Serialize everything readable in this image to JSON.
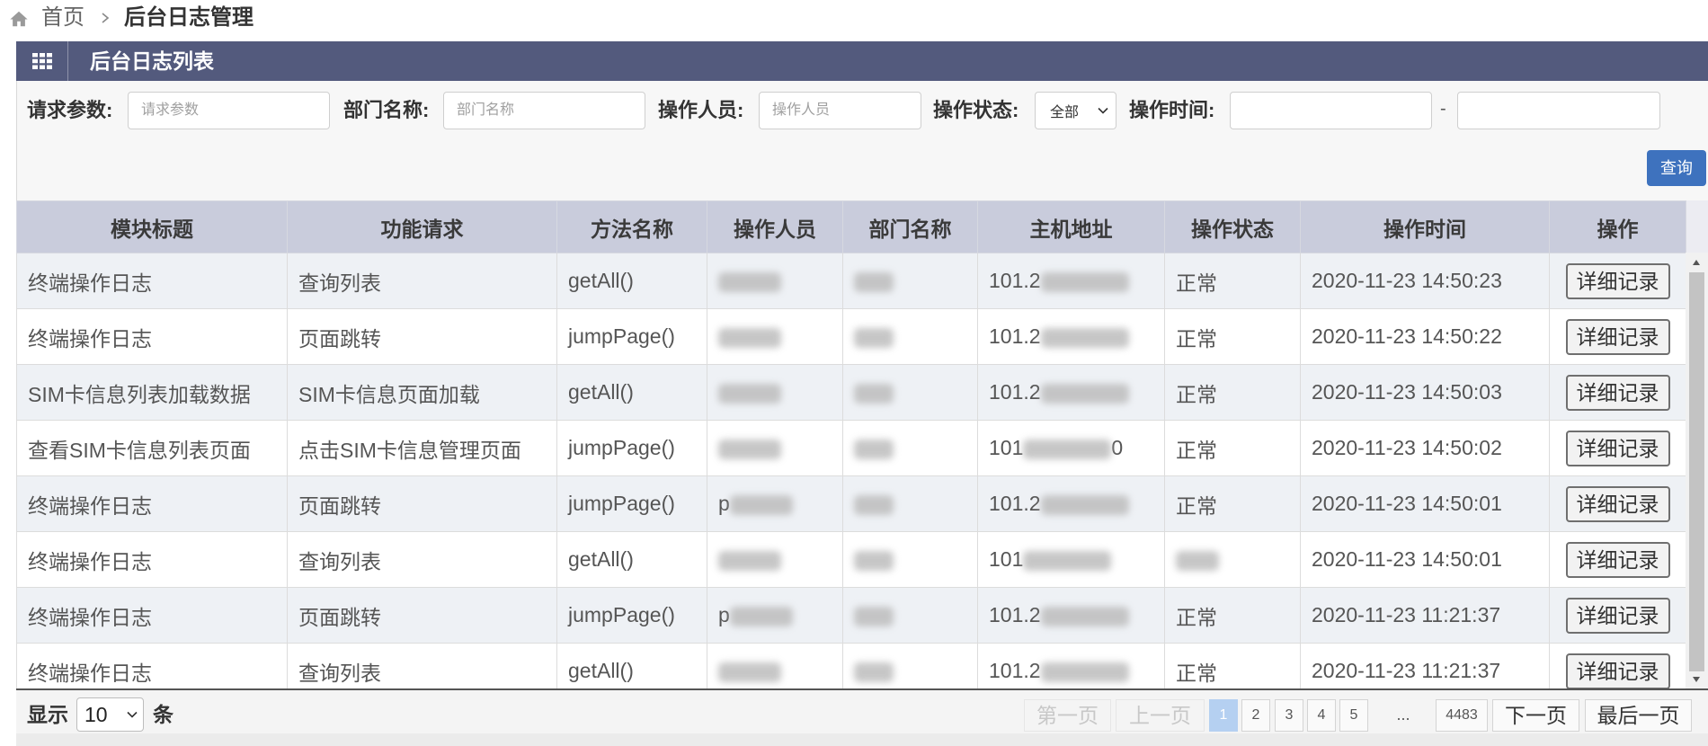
{
  "breadcrumb": {
    "home": "首页",
    "current": "后台日志管理"
  },
  "panel": {
    "title": "后台日志列表"
  },
  "filters": {
    "request_params": {
      "label": "请求参数:",
      "placeholder": "请求参数"
    },
    "dept_name": {
      "label": "部门名称:",
      "placeholder": "部门名称"
    },
    "operator": {
      "label": "操作人员:",
      "placeholder": "操作人员"
    },
    "status": {
      "label": "操作状态:",
      "selected": "全部"
    },
    "time": {
      "label": "操作时间:",
      "start": "",
      "end": "",
      "separator": "-"
    },
    "query_label": "查询"
  },
  "table": {
    "columns": [
      "模块标题",
      "功能请求",
      "方法名称",
      "操作人员",
      "部门名称",
      "主机地址",
      "操作状态",
      "操作时间",
      "操作"
    ],
    "action_label": "详细记录",
    "rows": [
      {
        "module": "终端操作日志",
        "function": "查询列表",
        "method": "getAll()",
        "operator": {
          "redacted": true
        },
        "dept": {
          "redacted": true
        },
        "host": {
          "prefix": "101.2",
          "redacted": true
        },
        "status": "正常",
        "time": "2020-11-23 14:50:23"
      },
      {
        "module": "终端操作日志",
        "function": "页面跳转",
        "method": "jumpPage()",
        "operator": {
          "redacted": true
        },
        "dept": {
          "redacted": true
        },
        "host": {
          "prefix": "101.2",
          "redacted": true
        },
        "status": "正常",
        "time": "2020-11-23 14:50:22"
      },
      {
        "module": "SIM卡信息列表加载数据",
        "function": "SIM卡信息页面加载",
        "method": "getAll()",
        "operator": {
          "redacted": true
        },
        "dept": {
          "redacted": true
        },
        "host": {
          "prefix": "101.2",
          "redacted": true
        },
        "status": "正常",
        "time": "2020-11-23 14:50:03"
      },
      {
        "module": "查看SIM卡信息列表页面",
        "function": "点击SIM卡信息管理页面",
        "method": "jumpPage()",
        "operator": {
          "redacted": true
        },
        "dept": {
          "redacted": true
        },
        "host": {
          "prefix": "101",
          "suffix": "0",
          "redacted": true
        },
        "status": "正常",
        "time": "2020-11-23 14:50:02"
      },
      {
        "module": "终端操作日志",
        "function": "页面跳转",
        "method": "jumpPage()",
        "operator": {
          "prefix": "p",
          "redacted": true
        },
        "dept": {
          "redacted": true
        },
        "host": {
          "prefix": "101.2",
          "redacted": true
        },
        "status": "正常",
        "time": "2020-11-23 14:50:01"
      },
      {
        "module": "终端操作日志",
        "function": "查询列表",
        "method": "getAll()",
        "operator": {
          "redacted": true
        },
        "dept": {
          "redacted": true
        },
        "host": {
          "prefix": "101",
          "redacted": true
        },
        "status": {
          "redacted": true
        },
        "time": "2020-11-23 14:50:01"
      },
      {
        "module": "终端操作日志",
        "function": "页面跳转",
        "method": "jumpPage()",
        "operator": {
          "prefix": "p",
          "redacted": true
        },
        "dept": {
          "redacted": true
        },
        "host": {
          "prefix": "101.2",
          "redacted": true
        },
        "status": "正常",
        "time": "2020-11-23 11:21:37"
      },
      {
        "module": "终端操作日志",
        "function": "查询列表",
        "method": "getAll()",
        "operator": {
          "redacted": true
        },
        "dept": {
          "redacted": true
        },
        "host": {
          "prefix": "101.2",
          "redacted": true
        },
        "status": "正常",
        "time": "2020-11-23 11:21:37"
      }
    ]
  },
  "pagination": {
    "show_label": "显示",
    "page_size": "10",
    "unit": "条",
    "first": "第一页",
    "prev": "上一页",
    "pages": [
      "1",
      "2",
      "3",
      "4",
      "5"
    ],
    "current_page": "1",
    "ellipsis": "...",
    "last_page_number": "4483",
    "next": "下一页",
    "last": "最后一页"
  },
  "colors": {
    "panel_header": "#535a7d",
    "table_header": "#c9ccdc",
    "row_alt": "#eef1f5",
    "query_button": "#3e72be",
    "active_page": "#b5d0f1"
  }
}
